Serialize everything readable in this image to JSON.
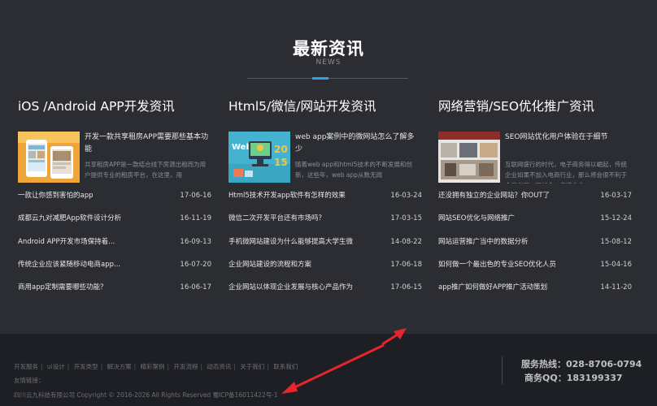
{
  "header": {
    "title": "最新资讯",
    "subtitle": "NEWS",
    "accent_color": "#2ea3e2"
  },
  "columns": [
    {
      "title": "iOS /Android APP开发资讯",
      "featured": {
        "image_icon": "phone-app-thumbnail",
        "title": "开发一款共享租房APP需要那些基本功能",
        "desc": "共享租房APP是一款结合线下房源出租而为用户提供专业的租房平台，在这里，用"
      },
      "items": [
        {
          "title": "一款让你感到害怕的app",
          "date": "17-06-16"
        },
        {
          "title": "成都云九对减肥App软件设计分析",
          "date": "16-11-19"
        },
        {
          "title": "Android APP开发市场保持着...",
          "date": "16-09-13"
        },
        {
          "title": "传统企业应该紧随移动电商app...",
          "date": "16-07-20"
        },
        {
          "title": "商用app定制需要哪些功能？",
          "date": "16-06-17"
        }
      ]
    },
    {
      "title": "Html5/微信/网站开发资讯",
      "featured": {
        "image_icon": "web-2015-thumbnail",
        "title": "web app案例中的微网站怎么了解多少",
        "desc": "随着web app和html5技术的不断发展和创新，这些年，web app从数无闻"
      },
      "items": [
        {
          "title": "Html5技术开发app软件有怎样的效果",
          "date": "16-03-24"
        },
        {
          "title": "微信二次开发平台还有市场吗？",
          "date": "17-03-15"
        },
        {
          "title": "手机微网站建设为什么能够提高大学生微",
          "date": "14-08-22"
        },
        {
          "title": "企业网站建设的流程和方案",
          "date": "17-06-18"
        },
        {
          "title": "企业网站以体现企业发展与核心产品作为",
          "date": "17-06-15"
        }
      ]
    },
    {
      "title": "网络营销/SEO优化推广资讯",
      "featured": {
        "image_icon": "seo-office-thumbnail",
        "title": "SEO网站优化用户体验在于细节",
        "desc": "互联网盛行的时代，电子商务得以崛起，传统企业如果不加入电商行业，那么将会很不利于今后发展。现如今，传统企业"
      },
      "items": [
        {
          "title": "还没拥有独立的企业网站？你OUT了",
          "date": "16-03-17"
        },
        {
          "title": "网站SEO优化与网络推广",
          "date": "15-12-24"
        },
        {
          "title": "网站运营推广当中的数据分析",
          "date": "15-08-12"
        },
        {
          "title": "如何做一个最出色的专业SEO优化人员",
          "date": "15-04-16"
        },
        {
          "title": "app推广如何做好APP推广活动策划",
          "date": "14-11-20"
        }
      ]
    }
  ],
  "footer": {
    "links": [
      "开发服务",
      "ui设计",
      "开发类型",
      "解决方案",
      "精彩案例",
      "开发流程",
      "动态资讯",
      "关于我们",
      "联系我们"
    ],
    "friend_links_label": "友情链接：",
    "copyright": "四川云九科技有限公司 Copyright © 2016-2026 All Rights Reserved 蜀ICP备16011422号-1",
    "hotline": "服务热线：028-8706-0794",
    "qq": "商务QQ：183199337"
  },
  "annotation_color": "#e8252b"
}
